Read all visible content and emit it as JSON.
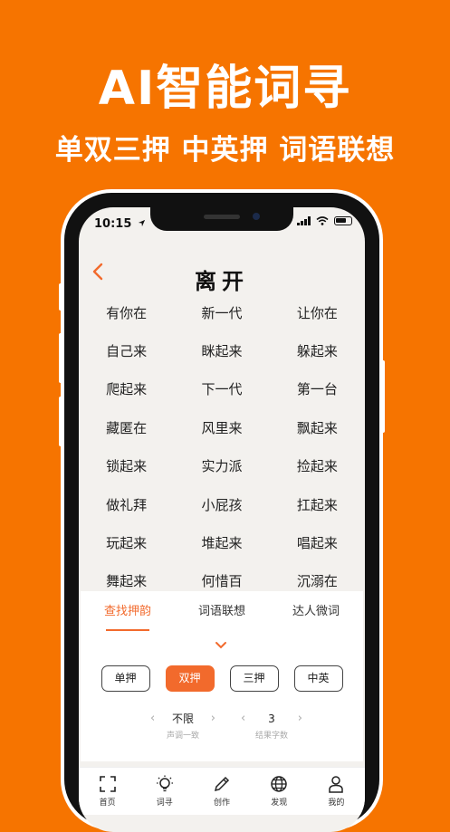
{
  "promo": {
    "title": "AI智能词寻",
    "subtitle": "单双三押 中英押 词语联想"
  },
  "status_bar": {
    "time": "10:15"
  },
  "header": {
    "title": "离开"
  },
  "results": [
    [
      "有你在",
      "新一代",
      "让你在"
    ],
    [
      "自己来",
      "眯起来",
      "躲起来"
    ],
    [
      "爬起来",
      "下一代",
      "第一台"
    ],
    [
      "藏匿在",
      "风里来",
      "飘起来"
    ],
    [
      "锁起来",
      "实力派",
      "捡起来"
    ],
    [
      "做礼拜",
      "小屁孩",
      "扛起来"
    ],
    [
      "玩起来",
      "堆起来",
      "唱起来"
    ],
    [
      "舞起来",
      "何惜百",
      "沉溺在"
    ]
  ],
  "tabs": [
    {
      "label": "查找押韵",
      "active": true
    },
    {
      "label": "词语联想",
      "active": false
    },
    {
      "label": "达人微词",
      "active": false
    }
  ],
  "rhyme_modes": [
    {
      "label": "单押",
      "active": false
    },
    {
      "label": "双押",
      "active": true
    },
    {
      "label": "三押",
      "active": false
    },
    {
      "label": "中英",
      "active": false
    }
  ],
  "tone_selector": {
    "value": "不限",
    "label": "声调一致"
  },
  "length_selector": {
    "value": "3",
    "label": "结果字数"
  },
  "nav": [
    {
      "label": "首页",
      "icon": "scan-icon"
    },
    {
      "label": "词寻",
      "icon": "lightbulb-icon"
    },
    {
      "label": "创作",
      "icon": "pencil-icon"
    },
    {
      "label": "发现",
      "icon": "globe-icon"
    },
    {
      "label": "我的",
      "icon": "user-icon"
    }
  ],
  "colors": {
    "background": "#f67400",
    "accent": "#f26a2c"
  }
}
